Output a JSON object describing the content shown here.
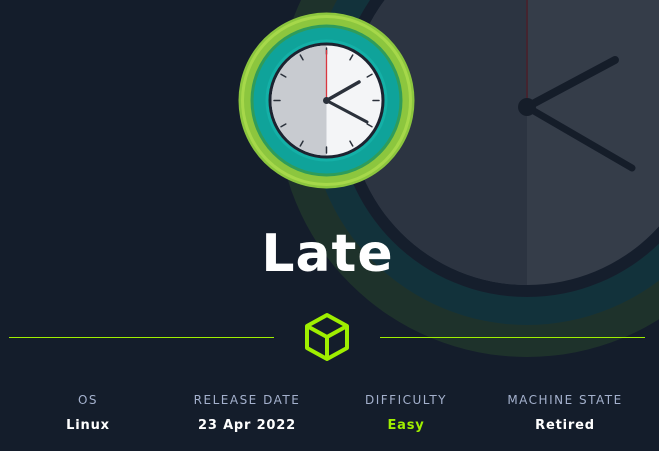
{
  "machine": {
    "name": "Late",
    "logo_icon": "clock-icon",
    "divider_icon": "cube-icon"
  },
  "info": [
    {
      "label": "OS",
      "value": "Linux"
    },
    {
      "label": "RELEASE DATE",
      "value": "23 Apr 2022"
    },
    {
      "label": "DIFFICULTY",
      "value": "Easy"
    },
    {
      "label": "MACHINE STATE",
      "value": "Retired"
    }
  ],
  "colors": {
    "background": "#141d2b",
    "accent": "#9fef00",
    "label": "#a4b1cd",
    "value": "#ffffff",
    "ring_teal": "#0fa39a"
  }
}
